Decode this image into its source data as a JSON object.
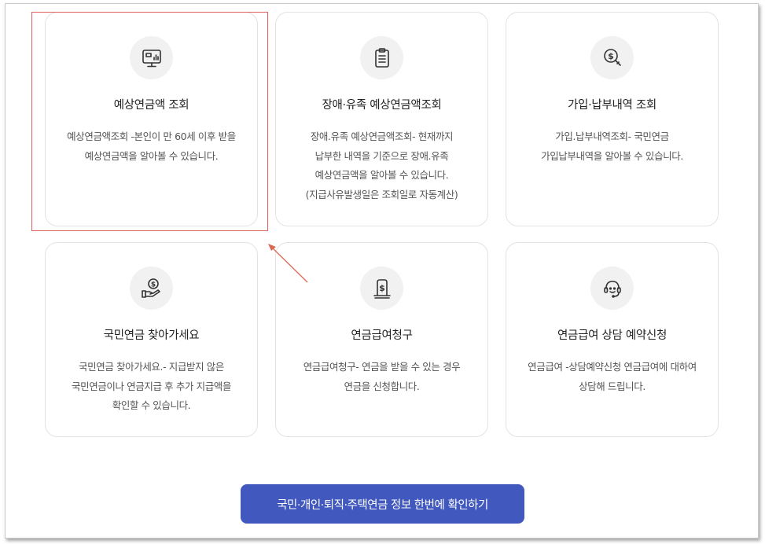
{
  "cards": [
    {
      "title": "예상연금액 조회",
      "icon": "monitor-chart-icon",
      "desc": [
        "예상연금액조회 -본인이 만 60세 이후 받을",
        "예상연금액을 알아볼 수 있습니다."
      ]
    },
    {
      "title": "장애·유족 예상연금액조회",
      "icon": "clipboard-list-icon",
      "desc": [
        "장애.유족 예상연금액조회- 현재까지",
        "납부한 내역을 기준으로 장애.유족",
        "예상연금액을 알아볼 수 있습니다.",
        "(지급사유발생일은 조회일로 자동계산)"
      ]
    },
    {
      "title": "가입·납부내역 조회",
      "icon": "dollar-search-icon",
      "desc": [
        "가입.납부내역조회- 국민연금",
        "가입납부내역을 알아볼 수 있습니다."
      ]
    },
    {
      "title": "국민연금 찾아가세요",
      "icon": "hand-coin-icon",
      "desc": [
        "국민연금 찾아가세요.- 지급받지 않은",
        "국민연금이나 연금지급 후 추가 지급액을",
        "확인할 수 있습니다."
      ]
    },
    {
      "title": "연금급여청구",
      "icon": "dollar-document-icon",
      "desc": [
        "연금급여청구- 연금을 받을 수 있는 경우",
        "연금을 신청합니다."
      ]
    },
    {
      "title": "연금급여 상담 예약신청",
      "icon": "headset-agent-icon",
      "desc": [
        "연금급여 -상담예약신청 연금급여에 대하여",
        "상담해 드립니다."
      ]
    }
  ],
  "cta": {
    "label": "국민·개인·퇴직·주택연금 정보 한번에 확인하기"
  },
  "colors": {
    "button": "#4158be",
    "highlight": "#e06060",
    "icon_bg": "#f1f1f1"
  }
}
